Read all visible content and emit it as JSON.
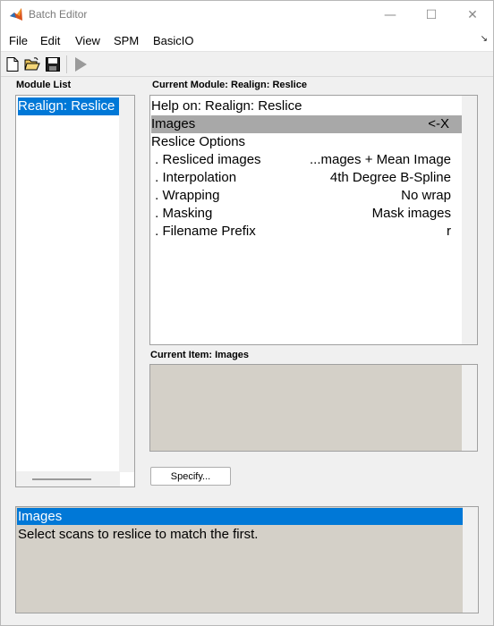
{
  "window": {
    "title": "Batch Editor",
    "controls": {
      "minimize": "—",
      "maximize": "☐",
      "close": "✕"
    }
  },
  "menubar": {
    "items": [
      "File",
      "Edit",
      "View",
      "SPM",
      "BasicIO"
    ],
    "corner": "↘"
  },
  "toolbar": {
    "buttons": [
      "new-file-icon",
      "open-folder-icon",
      "save-icon",
      "run-icon"
    ]
  },
  "module_list": {
    "label": "Module List",
    "items": [
      "Realign: Reslice"
    ]
  },
  "current_module": {
    "label": "Current Module: Realign: Reslice",
    "rows": [
      {
        "label": "Help on: Realign: Reslice",
        "value": ""
      },
      {
        "label": "Images",
        "value": "<-X"
      },
      {
        "label": "Reslice Options",
        "value": ""
      },
      {
        "label": " . Resliced images",
        "value": "...mages + Mean Image"
      },
      {
        "label": " . Interpolation",
        "value": "4th Degree B-Spline"
      },
      {
        "label": " . Wrapping",
        "value": "No wrap"
      },
      {
        "label": " . Masking",
        "value": "Mask images"
      },
      {
        "label": " . Filename Prefix",
        "value": "r"
      }
    ],
    "selected_index": 1
  },
  "current_item": {
    "label": "Current Item: Images"
  },
  "specify_button": "Specify...",
  "help": {
    "title": "Images",
    "text": "Select scans to reslice to match the first."
  },
  "colors": {
    "selection_blue": "#0078d7",
    "row_selected_gray": "#a8a8a8",
    "panel_gray": "#d4d0c8"
  }
}
